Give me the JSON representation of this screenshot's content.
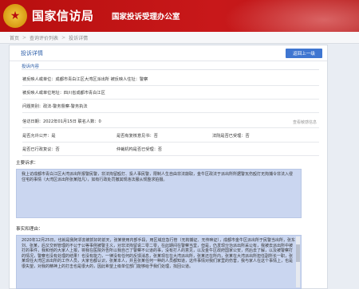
{
  "header": {
    "emblem_glyph": "★",
    "title": "国家信访局",
    "subtitle": "国家投诉受理办公室"
  },
  "breadcrumb": {
    "items": [
      "首页",
      "查询评价列表",
      "投诉详情"
    ],
    "separator": ">"
  },
  "panel": {
    "title": "投诉详情",
    "back_label": "返回上一级",
    "section_label": "投诉内容"
  },
  "fields": {
    "reported_unit": "被反映人或单位：成都市青白江区大湾区派出所 被反映人住址：警察",
    "reported_location": "被反映人或单位地址：四川省成都市青白江区",
    "category": "问题类别：政法-警务督察-警务执法",
    "date_line": "信访日期：2022年01月15日 联名人数：0",
    "sensitive_link": "查看敏感信息",
    "row3": {
      "public": "是否允许公开：是",
      "leader": "是否有复核意见书：否",
      "handling": "法院是否已受理：否"
    },
    "row4": {
      "admin": "是否已行政复议：否",
      "arbitration": "仲裁机构是否已受理：否"
    }
  },
  "main_request": {
    "label": "主要诉求：",
    "text": "我上访成都市青白江区大湾派出所报警民警，非法拘留殴打、投人事民警，限制人生自由非法敲取，金牛区政法于派出所所据警瓦伤殴打无拘捕令非法入侵住宅的事情（大湾区派出所张某陆凡），如有行政处罚撤其规违法服从规整求拍摄。"
  },
  "facts": {
    "label": "事实和理由：",
    "text": "2020年12月25日，也就是我阿邻去被抓好的前天，张某使用内部手段，用区域应急行管（无拘捕证、无传唤证），成都市金牛区派出所于民警当出所，张东刘、张某，后又交到管理的不公于公等事例被警主义，对非法拘留说二零二零，在此期间在警察当堂，但是，仍发现分治派出所采公有，我被去派出所中被打的事件，我和他的大家人上报，将我在医院外告所以我自己了警察不公道的事，没有打人的意见，以及金牛区政府国家公安，然后去了解，以及被警察打的情况，警察也没有处理的结果！也没有能力，一律没有任何的反馈消息，张某现在在大湾派出所，张某还在所内，张某在大湾派出所担任副所长一职，张某现任大湾区派出所的工作人员，大家也都认识，张某本人，并且张某任何一种的人员都知道，这件事情对我们家里的伤害，我与家人在这个事情上，也是很失望，对我的精神上的打击也是很大的，因此希望上级单位部门能够给予我们处理，找回公道。"
  }
}
